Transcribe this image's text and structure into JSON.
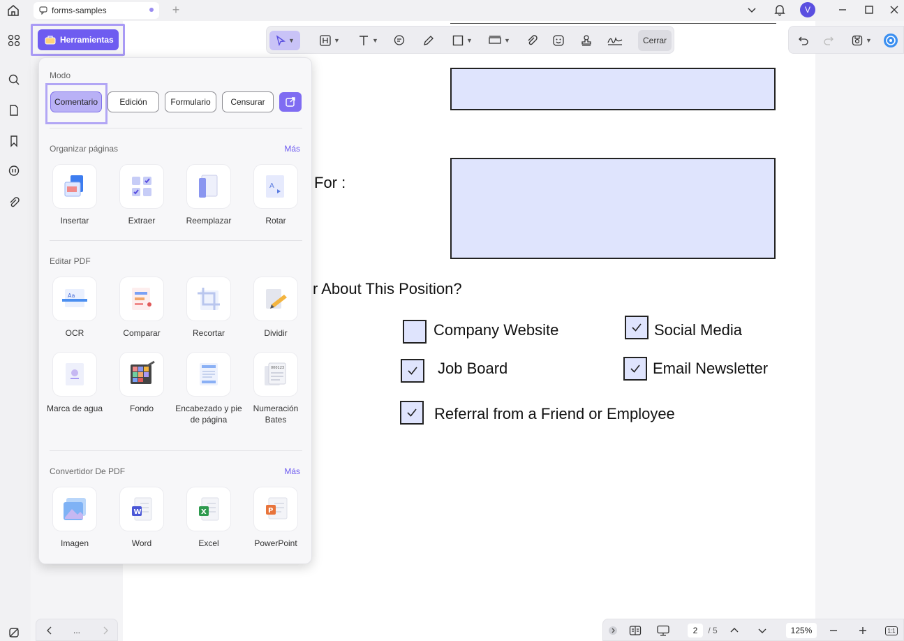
{
  "titlebar": {
    "tab_title": "forms-samples",
    "add_tab": "+",
    "avatar_initial": "V"
  },
  "tools_button": {
    "label": "Herramientas"
  },
  "toolbar": {
    "close_label": "Cerrar"
  },
  "panel": {
    "mode_title": "Modo",
    "modes": [
      {
        "label": "Comentario",
        "active": true
      },
      {
        "label": "Edición",
        "active": false
      },
      {
        "label": "Formulario",
        "active": false
      },
      {
        "label": "Censurar",
        "active": false
      }
    ],
    "organize": {
      "title": "Organizar páginas",
      "more": "Más",
      "items": [
        "Insertar",
        "Extraer",
        "Reemplazar",
        "Rotar"
      ]
    },
    "edit": {
      "title": "Editar PDF",
      "items": [
        "OCR",
        "Comparar",
        "Recortar",
        "Dividir",
        "Marca de agua",
        "Fondo",
        "Encabezado y pie de página",
        "Numeración Bates"
      ]
    },
    "convert": {
      "title": "Convertidor De PDF",
      "more": "Más",
      "items": [
        "Imagen",
        "Word",
        "Excel",
        "PowerPoint"
      ]
    }
  },
  "document": {
    "label_for": "For :",
    "question": "r About This Position?",
    "options": [
      {
        "label": "Company Website",
        "checked": false
      },
      {
        "label": "Social Media",
        "checked": true
      },
      {
        "label": "Job Board",
        "checked": true
      },
      {
        "label": "Email Newsletter",
        "checked": true
      },
      {
        "label": "Referral from a Friend or Employee",
        "checked": true
      }
    ]
  },
  "bottombar": {
    "page_current": "2",
    "page_total": "/ 5",
    "zoom": "125%",
    "nav_more": "...",
    "fit_label": "1:1"
  },
  "colors": {
    "accent": "#6e5cf0",
    "field_fill": "#dfe4fd"
  }
}
